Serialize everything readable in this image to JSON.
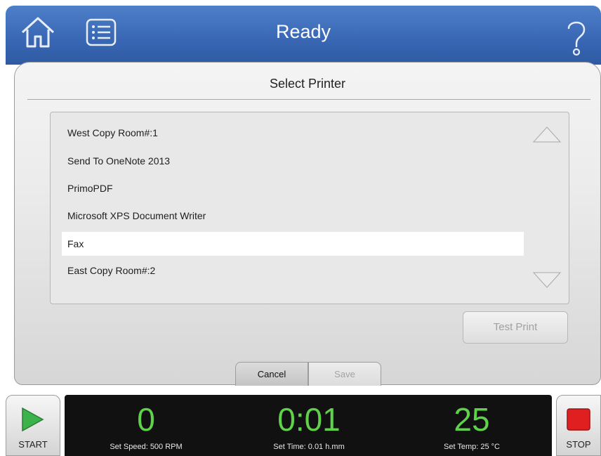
{
  "header": {
    "title": "Ready",
    "icons": {
      "home": "home-icon",
      "menu": "list-menu-icon",
      "help": "question-mark-icon"
    },
    "color": "#3a68b5"
  },
  "dialog": {
    "title": "Select Printer",
    "printers": [
      "West Copy Room#:1",
      "Send To OneNote 2013",
      "PrimoPDF",
      "Microsoft XPS Document Writer",
      "Fax",
      "East Copy Room#:2"
    ],
    "selected_printer": "Fax",
    "test_print_label": "Test Print",
    "cancel_label": "Cancel",
    "save_label": "Save"
  },
  "controls": {
    "start_label": "START",
    "stop_label": "STOP",
    "start_color": "#3bb34a",
    "stop_color": "#e02020"
  },
  "status": {
    "speed_value": "0",
    "speed_setting": "Set Speed: 500 RPM",
    "time_value": "0:01",
    "time_setting": "Set Time: 0.01 h.mm",
    "temp_value": "25",
    "temp_setting": "Set Temp: 25 °C",
    "value_color": "#5fd14a"
  }
}
